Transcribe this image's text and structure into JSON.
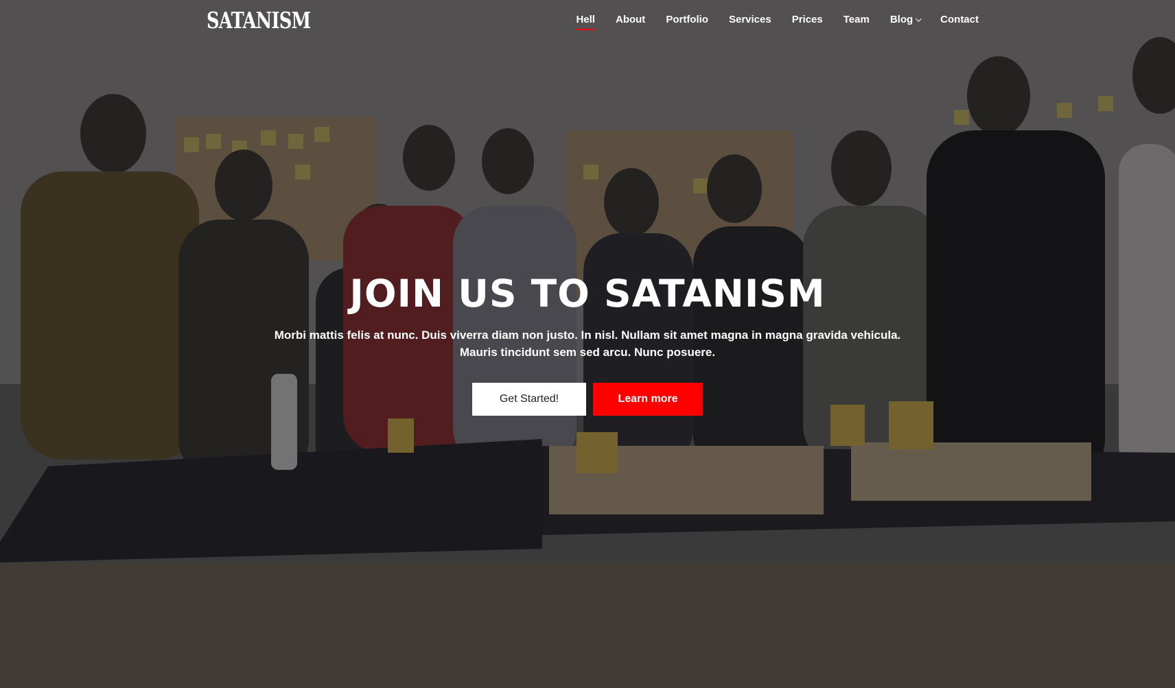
{
  "brand": {
    "logo_text": "SATANISM"
  },
  "nav": {
    "items": [
      {
        "label": "Hell",
        "active": true
      },
      {
        "label": "About"
      },
      {
        "label": "Portfolio"
      },
      {
        "label": "Services"
      },
      {
        "label": "Prices"
      },
      {
        "label": "Team"
      },
      {
        "label": "Blog",
        "dropdown": true
      },
      {
        "label": "Contact"
      }
    ]
  },
  "hero": {
    "title": "JOIN US TO SATANISM",
    "text": "Morbi mattis felis at nunc. Duis viverra diam non justo. In nisl. Nullam sit amet magna in magna gravida vehicula. Mauris tincidunt sem sed arcu. Nunc posuere.",
    "primary_button": "Get Started!",
    "secondary_button": "Learn more"
  },
  "colors": {
    "accent": "#ff0000",
    "overlay": "#121216",
    "text": "#ffffff"
  },
  "icons": {
    "dropdown": "chevron-down-icon"
  }
}
